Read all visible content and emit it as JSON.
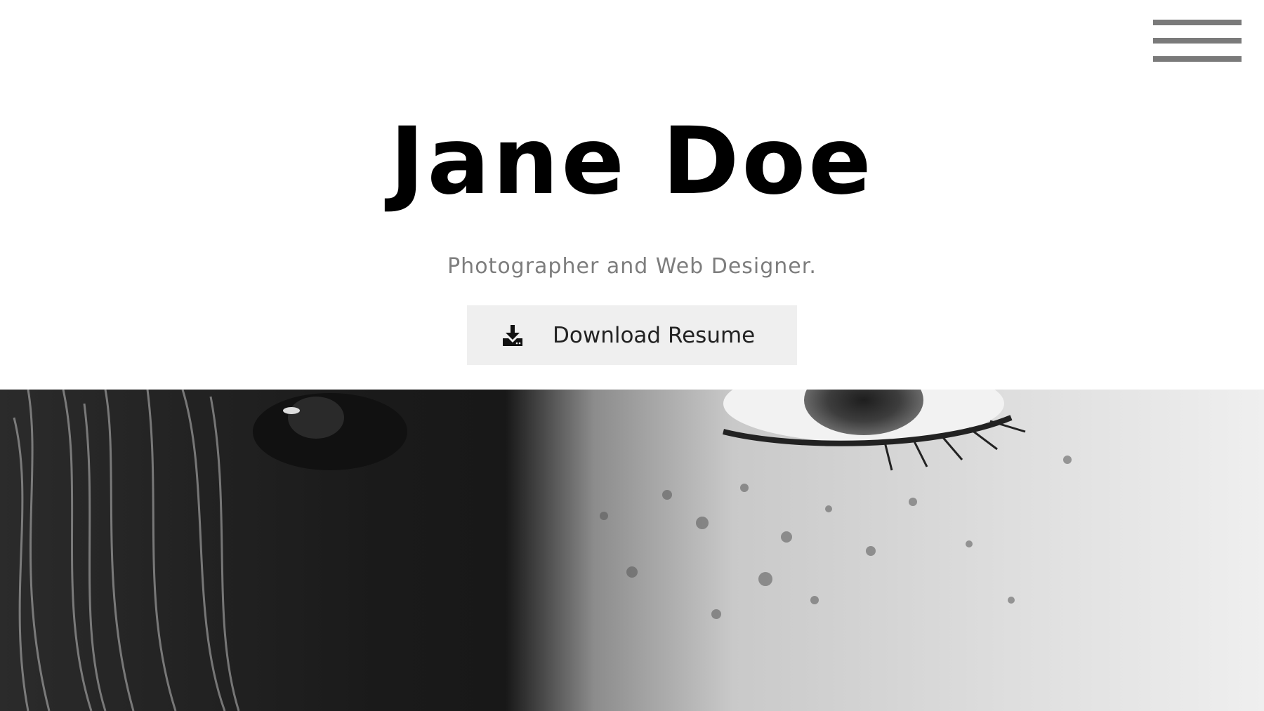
{
  "menu": {
    "icon": "hamburger-menu-icon"
  },
  "hero": {
    "name": "Jane Doe",
    "tagline": "Photographer and Web Designer.",
    "download_button": {
      "label": "Download Resume",
      "icon": "download-icon"
    }
  },
  "photo": {
    "alt": "",
    "style": "black-and-white close-up"
  },
  "colors": {
    "background": "#ffffff",
    "name": "#000000",
    "tagline": "#7d7d7d",
    "button_bg": "#efefef",
    "menu_bars": "#7a7a7a"
  }
}
